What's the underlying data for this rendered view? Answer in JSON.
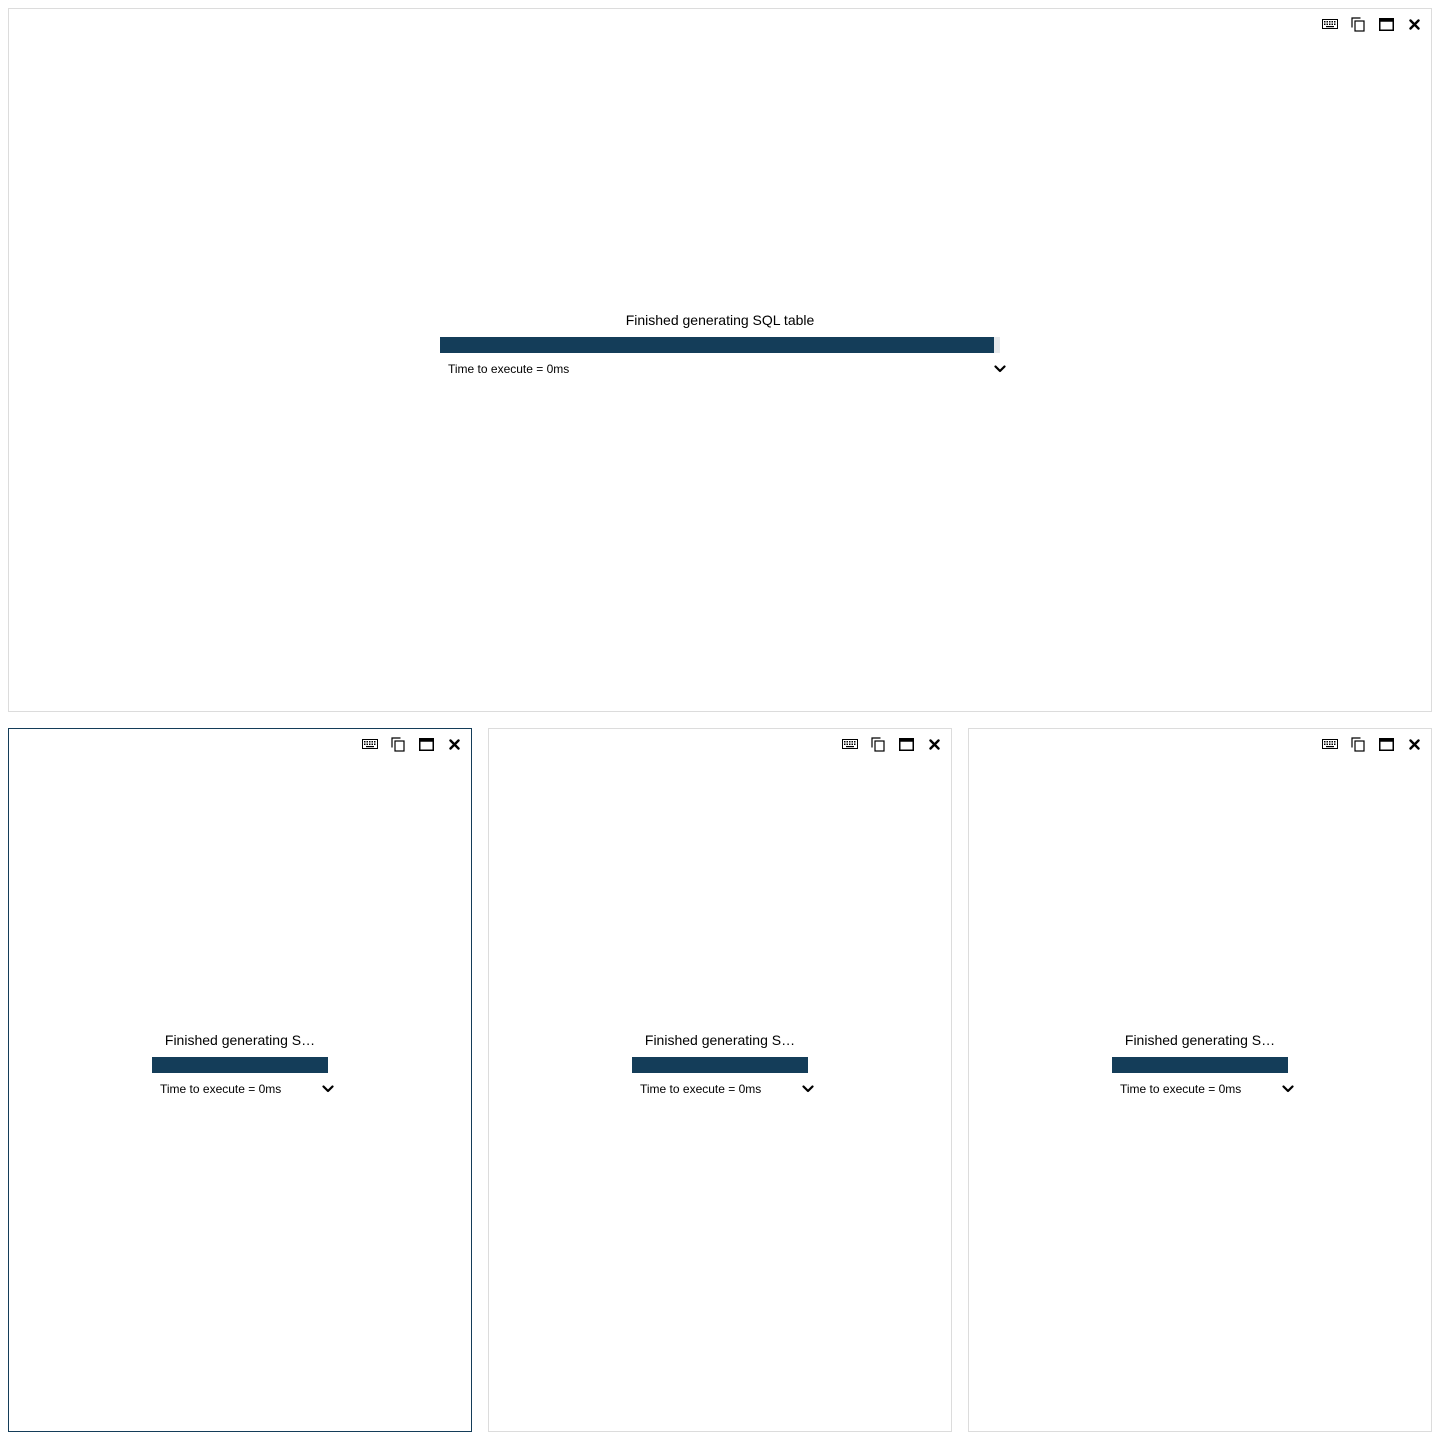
{
  "colors": {
    "accent": "#143d59",
    "panel_border": "#dcdcdc",
    "track": "#e6e9ec"
  },
  "toolbar_icons": [
    "keyboard-icon",
    "copy-icon",
    "maximize-icon",
    "close-icon"
  ],
  "panels": [
    {
      "status_title": "Finished generating SQL table",
      "progress": 0.99,
      "time_label": "Time to execute = 0ms",
      "active": false
    },
    {
      "status_title": "Finished generating S…",
      "progress": 1.0,
      "time_label": "Time to execute = 0ms",
      "active": true
    },
    {
      "status_title": "Finished generating S…",
      "progress": 1.0,
      "time_label": "Time to execute = 0ms",
      "active": false
    },
    {
      "status_title": "Finished generating S…",
      "progress": 1.0,
      "time_label": "Time to execute = 0ms",
      "active": false
    }
  ]
}
